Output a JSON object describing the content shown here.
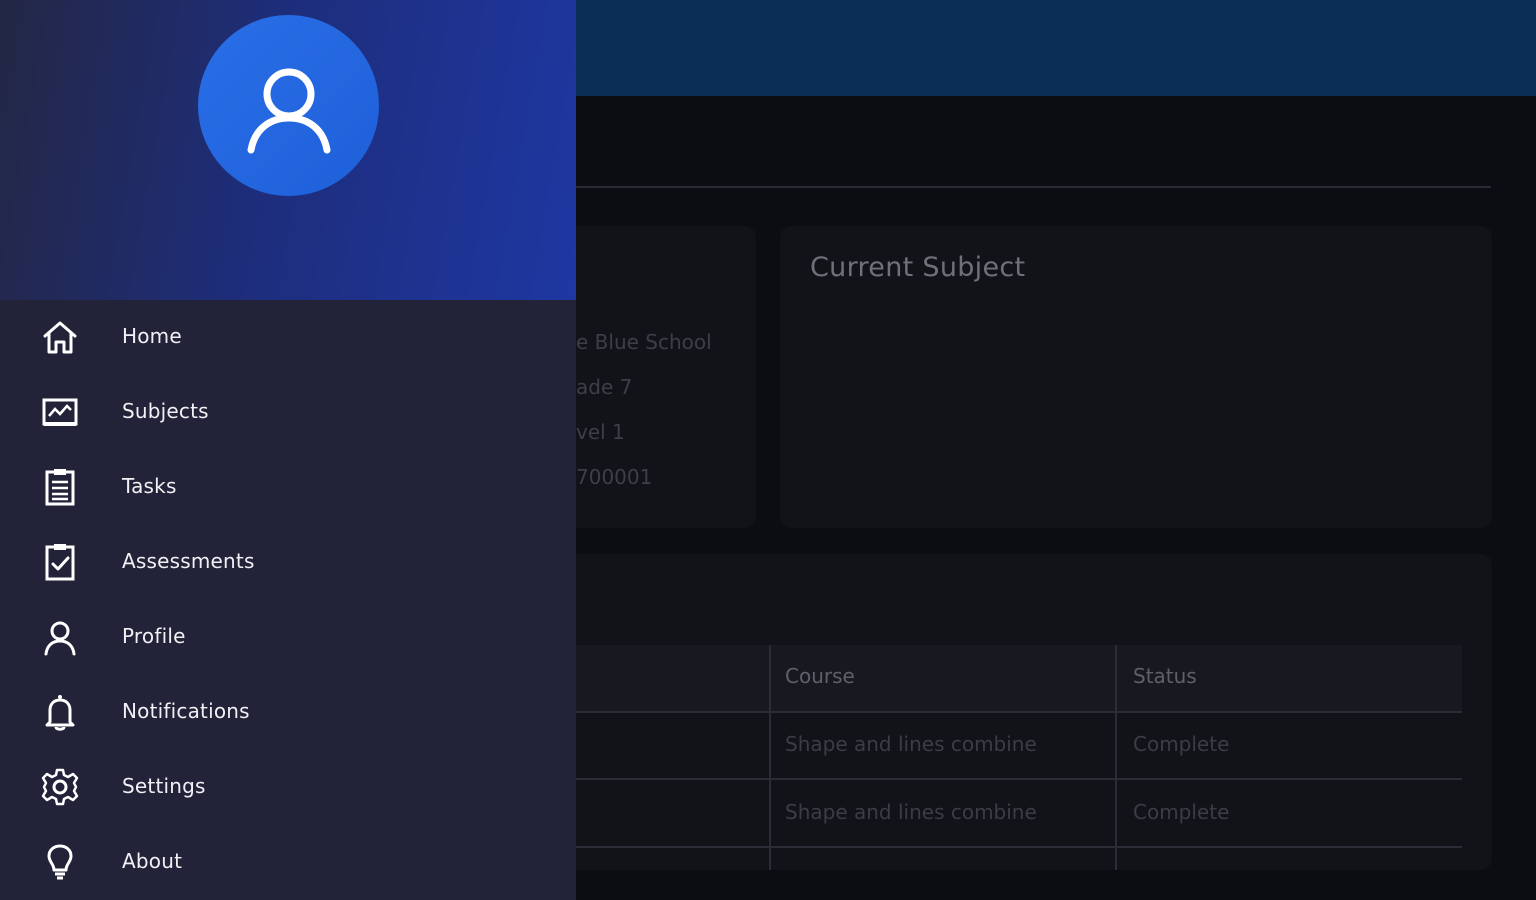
{
  "info_card": {
    "lines": [
      "e Blue School",
      "ade 7",
      "vel 1",
      "700001"
    ]
  },
  "subject_card": {
    "title": "Current Subject"
  },
  "table": {
    "headers": [
      "",
      "Course",
      "Status"
    ],
    "rows": [
      [
        "",
        "Shape and lines combine",
        "Complete"
      ],
      [
        "",
        "Shape and lines combine",
        "Complete"
      ]
    ]
  },
  "drawer": {
    "items": [
      {
        "label": "Home",
        "icon": "home-icon"
      },
      {
        "label": "Subjects",
        "icon": "chart-icon"
      },
      {
        "label": "Tasks",
        "icon": "clipboard-list-icon"
      },
      {
        "label": "Assessments",
        "icon": "clipboard-check-icon"
      },
      {
        "label": "Profile",
        "icon": "person-icon"
      },
      {
        "label": "Notifications",
        "icon": "bell-icon"
      },
      {
        "label": "Settings",
        "icon": "gear-icon"
      },
      {
        "label": "About",
        "icon": "lightbulb-icon"
      }
    ]
  },
  "colors": {
    "app_bar": "#0b2e57",
    "drawer_bg": "#222338",
    "avatar": "#1e5fd8"
  }
}
